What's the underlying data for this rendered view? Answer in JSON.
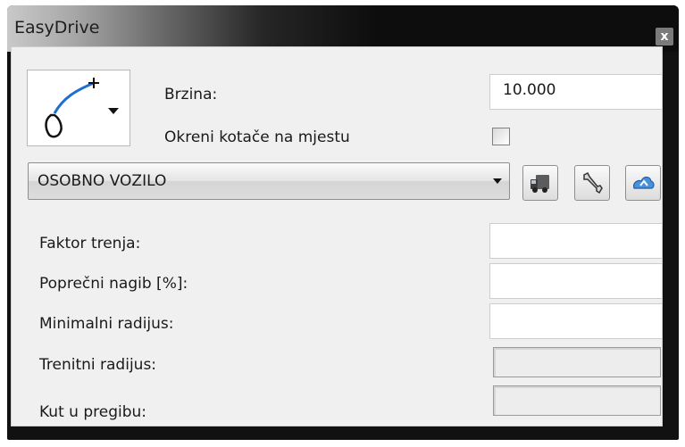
{
  "window": {
    "title": "EasyDrive",
    "close_glyph": "x"
  },
  "curve_selector": {
    "icon": "curve-path-icon",
    "dropdown_icon": "chevron-down-icon"
  },
  "speed": {
    "label": "Brzina:",
    "value": "10.000"
  },
  "rotate_in_place": {
    "label": "Okreni kotače na mjestu",
    "checked": false
  },
  "vehicle": {
    "selected": "OSOBNO VOZILO"
  },
  "toolbar": {
    "icons": [
      "truck-icon",
      "wrench-icon",
      "cloud-upload-icon"
    ]
  },
  "fields": {
    "friction": {
      "label": "Faktor trenja:",
      "value": ""
    },
    "cross_slope": {
      "label": "Poprečni nagib [%]:",
      "value": ""
    },
    "min_radius": {
      "label": "Minimalni radijus:",
      "value": ""
    },
    "friction_radius": {
      "label": "Trenitni radijus:",
      "value": ""
    },
    "break_angle": {
      "label": "Kut u pregibu:",
      "value": ""
    }
  },
  "colors": {
    "accent_blue": "#1e6fd0",
    "titlebar_dark": "#0d0d0d"
  }
}
